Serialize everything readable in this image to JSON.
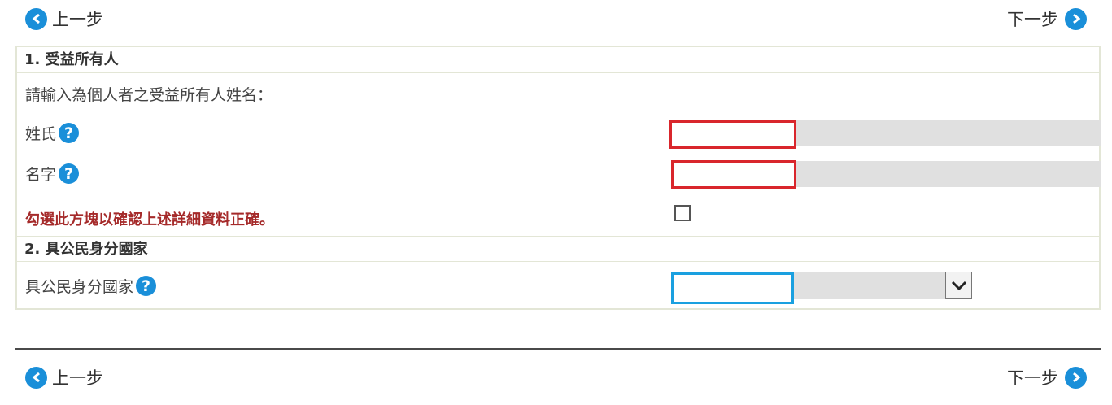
{
  "nav": {
    "prev_label": "上一步",
    "next_label": "下一步"
  },
  "section1": {
    "title": "1. 受益所有人",
    "instruction": "請輸入為個人者之受益所有人姓名：",
    "surname_label": "姓氏",
    "given_name_label": "名字",
    "surname_value": "",
    "given_name_value": "",
    "confirm_label": "勾選此方塊以確認上述詳細資料正確。"
  },
  "section2": {
    "title": "2. 具公民身分國家",
    "country_label": "具公民身分國家",
    "country_value": ""
  },
  "icons": {
    "help": "?"
  },
  "colors": {
    "accent": "#1a8fd9",
    "error": "#d9262c",
    "confirm_text": "#a52a2a",
    "focus": "#1aa0e0"
  }
}
